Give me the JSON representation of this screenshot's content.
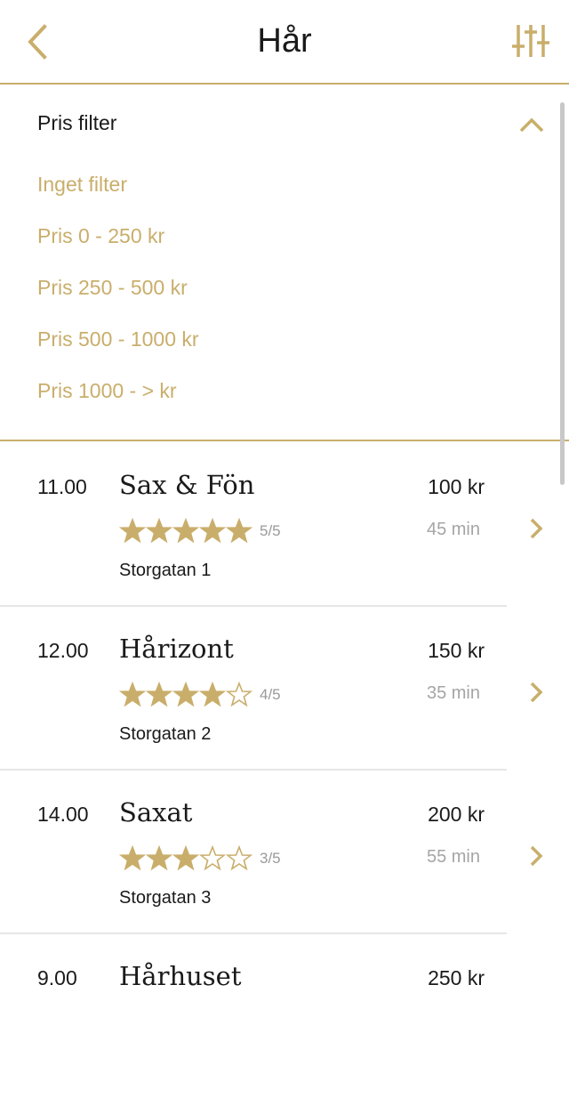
{
  "colors": {
    "accent": "#c9ae6b",
    "text": "#1a1a1a",
    "muted": "#a5a5a5",
    "separator": "#e6e6e6"
  },
  "header": {
    "title": "Hår",
    "back_icon": "chevron-left-icon",
    "filter_icon": "sliders-icon"
  },
  "filter": {
    "heading": "Pris filter",
    "collapse_icon": "chevron-up-icon",
    "options": [
      "Inget filter",
      "Pris 0 - 250 kr",
      "Pris 250 - 500 kr",
      "Pris 500 - 1000 kr",
      "Pris 1000 - > kr"
    ]
  },
  "salons": [
    {
      "time": "11.00",
      "name": "Sax & Fön",
      "rating": 5,
      "rating_text": "5/5",
      "address": "Storgatan 1",
      "price": "100 kr",
      "duration": "45 min"
    },
    {
      "time": "12.00",
      "name": "Hårizont",
      "rating": 4,
      "rating_text": "4/5",
      "address": "Storgatan 2",
      "price": "150 kr",
      "duration": "35 min"
    },
    {
      "time": "14.00",
      "name": "Saxat",
      "rating": 3,
      "rating_text": "3/5",
      "address": "Storgatan 3",
      "price": "200 kr",
      "duration": "55 min"
    },
    {
      "time": "9.00",
      "name": "Hårhuset",
      "price": "250 kr"
    }
  ]
}
